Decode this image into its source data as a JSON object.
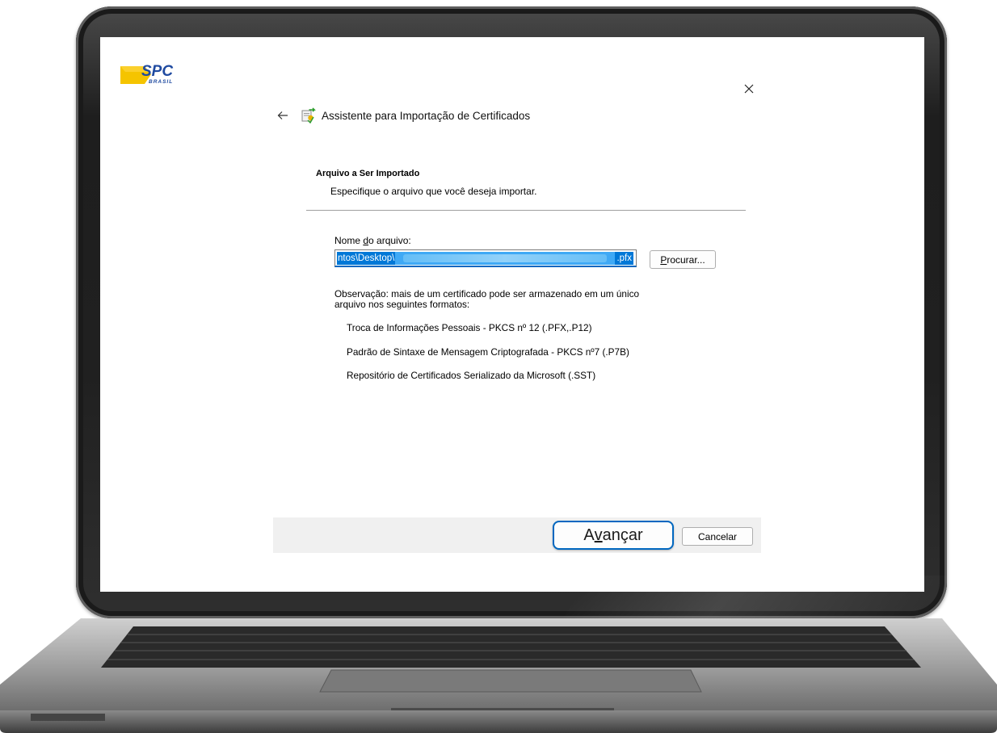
{
  "window": {
    "title": "Assistente para Importação de Certificados",
    "back_icon": "arrow-left-icon",
    "close_icon": "close-icon",
    "wizard_icon": "certificate-import-icon"
  },
  "brand": {
    "logo_text": "SPC",
    "logo_subtext": "BRASIL",
    "logo_colors": [
      "#f5c400",
      "#1f4aa0"
    ]
  },
  "page": {
    "heading": "Arquivo a Ser Importado",
    "subheading": "Especifique o arquivo que você deseja importar."
  },
  "file_field": {
    "label_before": "Nome ",
    "label_accel": "d",
    "label_after": "o arquivo:",
    "value_prefix": "ntos\\Desktop\\",
    "value_suffix": ".pfx"
  },
  "browse_button": {
    "accel": "P",
    "rest": "rocurar..."
  },
  "note": "Observação: mais de um certificado pode ser armazenado em um único arquivo nos seguintes formatos:",
  "formats": [
    "Troca de Informações Pessoais - PKCS nº 12 (.PFX,.P12)",
    "Padrão de Sintaxe de Mensagem Criptografada - PKCS nº7 (.P7B)",
    "Repositório de Certificados Serializado da Microsoft (.SST)"
  ],
  "footer": {
    "next_before": "A",
    "next_accel": "v",
    "next_after": "ançar",
    "cancel_label": "Cancelar"
  },
  "colors": {
    "accent": "#0067c0",
    "selection": "#0078d7",
    "footer_bg": "#f0f0f0"
  }
}
